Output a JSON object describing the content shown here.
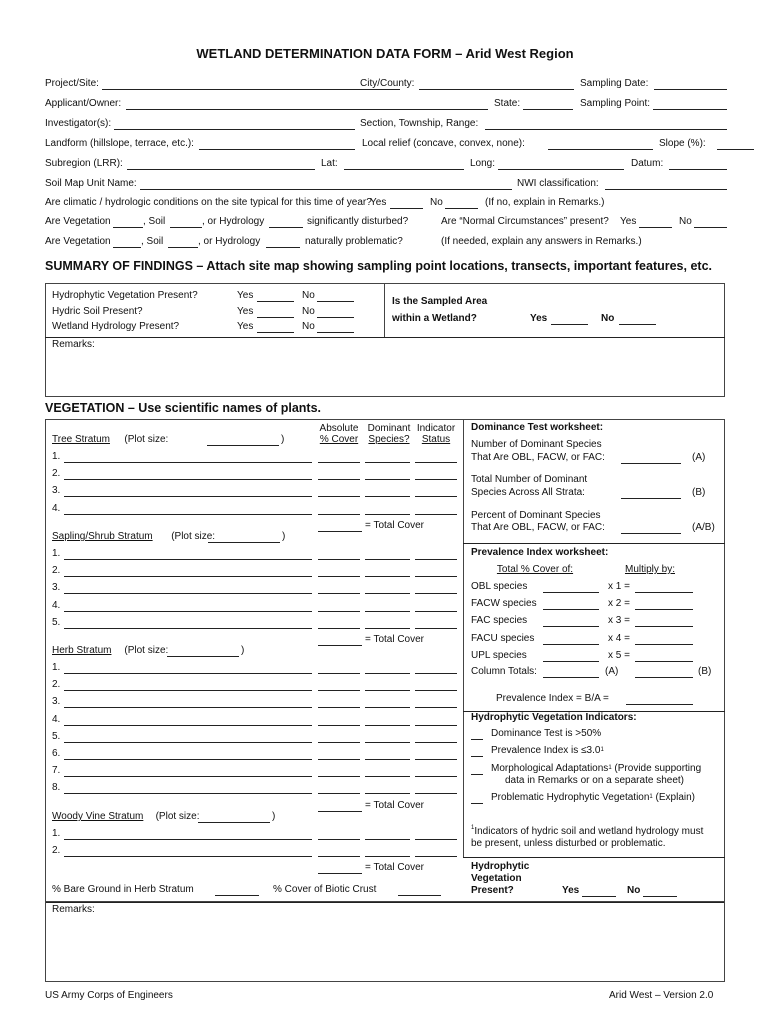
{
  "title": "WETLAND DETERMINATION DATA FORM – Arid West Region",
  "header_fields": {
    "project_site": "Project/Site:",
    "city_county": "City/County:",
    "sampling_date": "Sampling Date:",
    "applicant_owner": "Applicant/Owner:",
    "state": "State:",
    "sampling_point": "Sampling Point:",
    "investigators": "Investigator(s):",
    "section_township_range": "Section, Township, Range:",
    "landform": "Landform (hillslope, terrace, etc.):",
    "local_relief": "Local relief (concave, convex, none):",
    "slope": "Slope (%):",
    "subregion": "Subregion (LRR):",
    "lat": "Lat:",
    "long": "Long:",
    "datum": "Datum:",
    "soil_map_unit": "Soil Map Unit Name:",
    "nwi": "NWI classification:"
  },
  "questions": {
    "climatic": "Are climatic / hydrologic conditions on the site typical for this time of year?",
    "yes": "Yes",
    "no": "No",
    "if_no": "(If no, explain in Remarks.)",
    "are_vegetation": "Are Vegetation",
    "soil": ", Soil",
    "or_hydrology": ", or Hydrology",
    "significantly_disturbed": "significantly disturbed?",
    "normal_circumstances": "Are “Normal Circumstances” present?",
    "naturally_problematic": "naturally problematic?",
    "if_needed": "(If needed, explain any answers in Remarks.)"
  },
  "summary": {
    "heading": "SUMMARY OF FINDINGS –  Attach site map showing sampling point locations, transects, important features, etc.",
    "items": [
      "Hydrophytic Vegetation Present?",
      "Hydric Soil Present?",
      "Wetland Hydrology Present?"
    ],
    "yes": "Yes",
    "no": "No",
    "sampled_area_line1": "Is the Sampled Area",
    "sampled_area_line2": "within a Wetland?",
    "remarks": "Remarks:"
  },
  "vegetation": {
    "heading": "VEGETATION – Use scientific names of plants.",
    "col_absolute_1": "Absolute",
    "col_absolute_2": "% Cover",
    "col_dominant_1": "Dominant",
    "col_dominant_2": "Species?",
    "col_indicator_1": "Indicator",
    "col_indicator_2": "Status",
    "plot_size": "(Plot size:",
    "close_paren": ")",
    "total_cover": "= Total Cover",
    "strata": [
      {
        "name": "Tree Stratum",
        "rows": [
          "1.",
          "2.",
          "3.",
          "4."
        ]
      },
      {
        "name": "Sapling/Shrub Stratum",
        "rows": [
          "1.",
          "2.",
          "3.",
          "4.",
          "5."
        ]
      },
      {
        "name": "Herb Stratum",
        "rows": [
          "1.",
          "2.",
          "3.",
          "4.",
          "5.",
          "6.",
          "7.",
          "8."
        ]
      },
      {
        "name": "Woody Vine Stratum",
        "rows": [
          "1.",
          "2."
        ]
      }
    ],
    "bare_ground": "% Bare Ground in Herb Stratum",
    "biotic_crust": "% Cover of Biotic Crust",
    "remarks": "Remarks:"
  },
  "dominance": {
    "heading": "Dominance Test worksheet:",
    "a_line1": "Number of Dominant Species",
    "a_line2": "That Are OBL, FACW, or FAC:",
    "a_tag": "(A)",
    "b_line1": "Total Number of Dominant",
    "b_line2": "Species Across All Strata:",
    "b_tag": "(B)",
    "ab_line1": "Percent of Dominant Species",
    "ab_line2": "That Are OBL, FACW, or FAC:",
    "ab_tag": "(A/B)"
  },
  "prevalence": {
    "heading": "Prevalence Index worksheet:",
    "col1": "Total % Cover of:",
    "col2": "Multiply by:",
    "rows": [
      {
        "label": "OBL species",
        "mult": "x 1 ="
      },
      {
        "label": "FACW species",
        "mult": "x 2 ="
      },
      {
        "label": "FAC species",
        "mult": "x 3 ="
      },
      {
        "label": "FACU species",
        "mult": "x 4 ="
      },
      {
        "label": "UPL species",
        "mult": "x 5 ="
      }
    ],
    "column_totals": "Column Totals:",
    "a_tag": "(A)",
    "b_tag": "(B)",
    "index": "Prevalence Index  = B/A ="
  },
  "indicators": {
    "heading": "Hydrophytic Vegetation Indicators:",
    "items": [
      "Dominance Test is >50%",
      "Prevalence Index is ≤3.0",
      "Morphological Adaptations",
      "Problematic Hydrophytic Vegetation"
    ],
    "morph_suffix": " (Provide supporting",
    "morph_line2": "data in Remarks or on a separate sheet)",
    "problematic_suffix": " (Explain)",
    "footnote_mark": "1",
    "footnote_line1": "Indicators of hydric soil and wetland hydrology must",
    "footnote_line2": "be present, unless disturbed or problematic."
  },
  "hydro_present": {
    "line1": "Hydrophytic",
    "line2": "Vegetation",
    "line3": "Present?",
    "yes": "Yes",
    "no": "No"
  },
  "footer": {
    "left": "US Army Corps of Engineers",
    "right": "Arid West – Version 2.0"
  }
}
